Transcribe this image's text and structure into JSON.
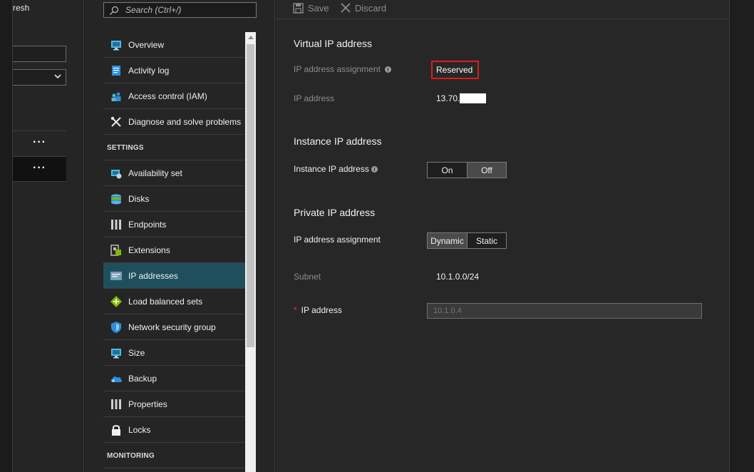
{
  "left_blade": {
    "refresh_label": "resh"
  },
  "search": {
    "placeholder": "Search (Ctrl+/)"
  },
  "nav": {
    "items_top": [
      {
        "label": "Overview",
        "icon": "overview-icon"
      },
      {
        "label": "Activity log",
        "icon": "activity-log-icon"
      },
      {
        "label": "Access control (IAM)",
        "icon": "access-control-icon"
      },
      {
        "label": "Diagnose and solve problems",
        "icon": "wrench-icon"
      }
    ],
    "settings_header": "SETTINGS",
    "items_settings": [
      {
        "label": "Availability set",
        "icon": "availability-set-icon"
      },
      {
        "label": "Disks",
        "icon": "disks-icon"
      },
      {
        "label": "Endpoints",
        "icon": "endpoints-icon"
      },
      {
        "label": "Extensions",
        "icon": "extensions-icon"
      },
      {
        "label": "IP addresses",
        "icon": "ip-addresses-icon",
        "active": true
      },
      {
        "label": "Load balanced sets",
        "icon": "load-balanced-sets-icon"
      },
      {
        "label": "Network security group",
        "icon": "shield-icon"
      },
      {
        "label": "Size",
        "icon": "size-icon"
      },
      {
        "label": "Backup",
        "icon": "cloud-backup-icon"
      },
      {
        "label": "Properties",
        "icon": "properties-icon"
      },
      {
        "label": "Locks",
        "icon": "lock-icon"
      }
    ],
    "monitoring_header": "MONITORING"
  },
  "toolbar": {
    "save_label": "Save",
    "discard_label": "Discard"
  },
  "virtual_ip": {
    "title": "Virtual IP address",
    "assignment_label": "IP address assignment",
    "assignment_value": "Reserved",
    "ip_label": "IP address",
    "ip_value": "13.70.1"
  },
  "instance_ip": {
    "title": "Instance IP address",
    "label": "Instance IP address",
    "options": [
      "On",
      "Off"
    ],
    "selected": "Off"
  },
  "private_ip": {
    "title": "Private IP address",
    "assignment_label": "IP address assignment",
    "options": [
      "Dynamic",
      "Static"
    ],
    "selected": "Dynamic",
    "subnet_label": "Subnet",
    "subnet_value": "10.1.0.0/24",
    "ip_label": "IP address",
    "ip_placeholder": "10.1.0.4"
  },
  "colors": {
    "highlight_border": "#e01b1b",
    "active_nav": "#1f4f5d",
    "required_star": "#e0393a"
  }
}
